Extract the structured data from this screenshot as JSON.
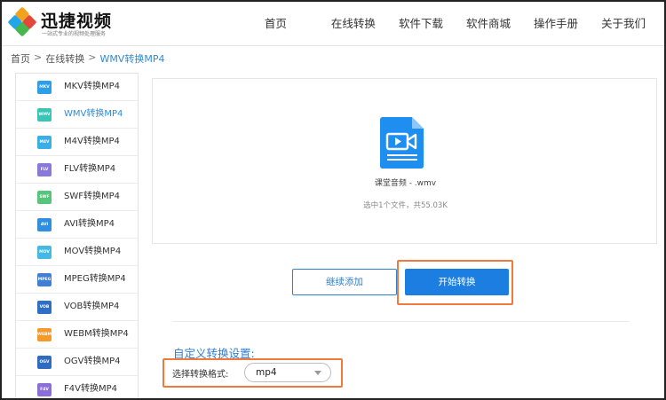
{
  "brand": {
    "title": "迅捷视频",
    "tagline": "一站式专业的视频处理服务"
  },
  "nav": {
    "items": [
      "首页",
      "在线转换",
      "软件下载",
      "软件商城",
      "操作手册",
      "关于我们"
    ]
  },
  "breadcrumb": {
    "items": [
      "首页",
      "在线转换",
      "WMV转换MP4"
    ],
    "separator": ">"
  },
  "sidebar": {
    "active_index": 1,
    "items": [
      {
        "tag": "MKV",
        "label": "MKV转换MP4",
        "color": "#2f9ee8"
      },
      {
        "tag": "WMV",
        "label": "WMV转换MP4",
        "color": "#39c5b3"
      },
      {
        "tag": "M4V",
        "label": "M4V转换MP4",
        "color": "#3aaee6"
      },
      {
        "tag": "FLV",
        "label": "FLV转换MP4",
        "color": "#8a79d8"
      },
      {
        "tag": "SWF",
        "label": "SWF转换MP4",
        "color": "#56c47a"
      },
      {
        "tag": "AVI",
        "label": "AVI转换MP4",
        "color": "#2f8ee0"
      },
      {
        "tag": "MOV",
        "label": "MOV转换MP4",
        "color": "#45b8e4"
      },
      {
        "tag": "MPEG",
        "label": "MPEG转换MP4",
        "color": "#3f7fd6"
      },
      {
        "tag": "VOB",
        "label": "VOB转换MP4",
        "color": "#2d6fc4"
      },
      {
        "tag": "WEBM",
        "label": "WEBM转换MP4",
        "color": "#f39a2b"
      },
      {
        "tag": "OGV",
        "label": "OGV转换MP4",
        "color": "#2f6bbf"
      },
      {
        "tag": "F4V",
        "label": "F4V转换MP4",
        "color": "#8b6fd6"
      }
    ]
  },
  "upload": {
    "file_icon": "video-file-icon",
    "file_name": "课堂音频 - .wmv",
    "summary": "选中1个文件，共55.03K"
  },
  "actions": {
    "add_label": "继续添加",
    "start_label": "开始转换"
  },
  "settings": {
    "title": "自定义转换设置:",
    "format_label": "选择转换格式:",
    "format_value": "mp4"
  },
  "colors": {
    "accent": "#1d7ee1",
    "highlight": "#f07a3b",
    "file_icon": "#1f8ef1"
  }
}
